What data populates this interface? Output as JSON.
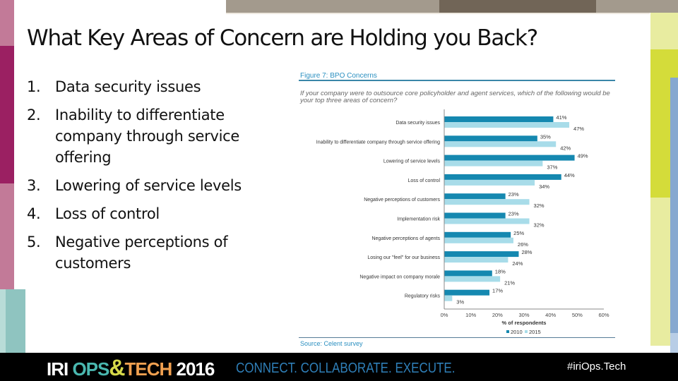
{
  "slide": {
    "title": "What Key Areas of Concern are Holding you Back?",
    "list": [
      {
        "num": "1.",
        "text": "Data security issues"
      },
      {
        "num": "2.",
        "text": "Inability to differentiate company through service offering"
      },
      {
        "num": "3.",
        "text": "Lowering of service levels"
      },
      {
        "num": "4.",
        "text": "Loss of control"
      },
      {
        "num": "5.",
        "text": "Negative perceptions of customers"
      }
    ]
  },
  "figure": {
    "title": "Figure 7: BPO Concerns",
    "question": "If your company were to outsource core policyholder and agent services, which of the following would be your top three areas of concern?",
    "source": "Source: Celent survey"
  },
  "chart_data": {
    "type": "bar",
    "orientation": "horizontal",
    "title": "Figure 7: BPO Concerns",
    "xlabel": "% of respondents",
    "ylabel": "",
    "xlim": [
      0,
      60
    ],
    "xticks": [
      "0%",
      "10%",
      "20%",
      "30%",
      "40%",
      "50%",
      "60%"
    ],
    "categories": [
      "Data security issues",
      "Inability to differentiate company through service offering",
      "Lowering of service levels",
      "Loss of control",
      "Negative perceptions of customers",
      "Implementation risk",
      "Negative perceptions of agents",
      "Losing our \"feel\" for our business",
      "Negative impact on company morale",
      "Regulatory risks"
    ],
    "series": [
      {
        "name": "2010",
        "color": "#1588b0",
        "values": [
          41,
          35,
          49,
          44,
          23,
          23,
          25,
          28,
          18,
          17
        ]
      },
      {
        "name": "2015",
        "color": "#a8dce9",
        "values": [
          47,
          42,
          37,
          34,
          32,
          32,
          26,
          24,
          21,
          3
        ]
      }
    ],
    "legend": "bottom-center",
    "grid": false
  },
  "footer": {
    "logo_iri": "IRI ",
    "logo_ops": "OPS",
    "logo_amp": "&",
    "logo_tech": "TECH",
    "logo_year": " 2016",
    "tagline": "CONNECT. COLLABORATE. EXECUTE.",
    "hashtag": "#iriOps.Tech"
  }
}
